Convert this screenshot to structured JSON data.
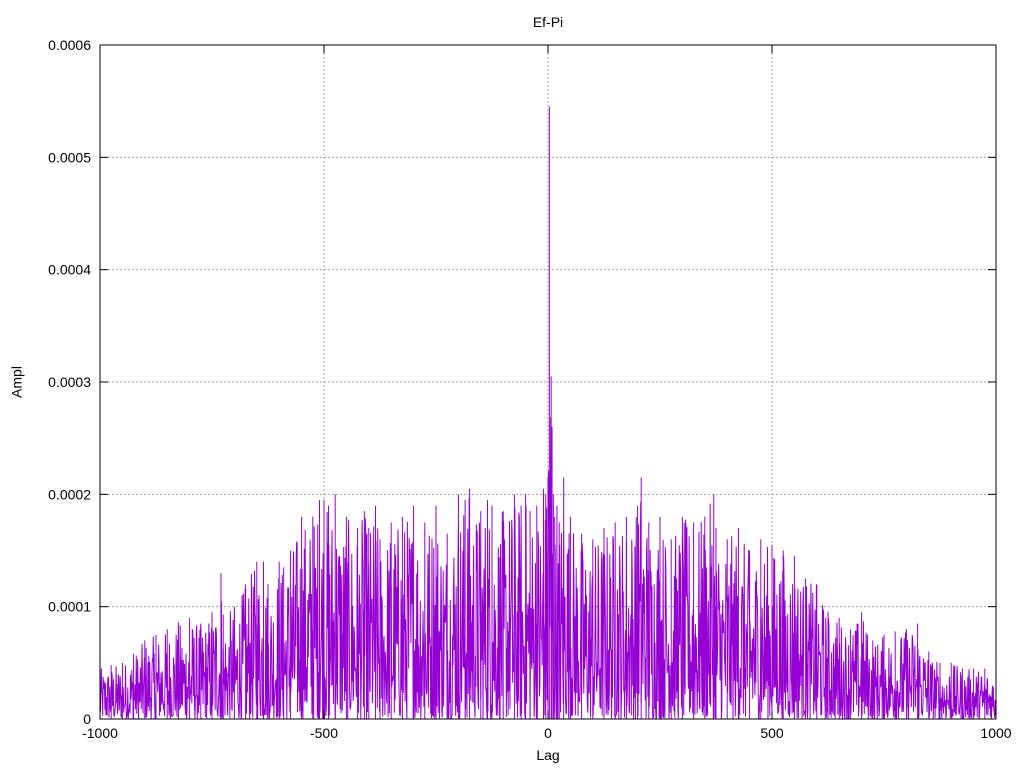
{
  "chart_data": {
    "type": "line",
    "title": "Ef-Pi",
    "xlabel": "Lag",
    "ylabel": "Ampl",
    "xlim": [
      -1000,
      1000
    ],
    "ylim": [
      0,
      0.0006
    ],
    "x_ticks": [
      -1000,
      -500,
      0,
      500,
      1000
    ],
    "x_tick_labels": [
      "-1000",
      "-500",
      "0",
      "500",
      "1000"
    ],
    "y_ticks": [
      0,
      0.0001,
      0.0002,
      0.0003,
      0.0004,
      0.0005,
      0.0006
    ],
    "y_tick_labels": [
      "0",
      "0.0001",
      "0.0002",
      "0.0003",
      "0.0004",
      "0.0005",
      "0.0006"
    ],
    "grid": true,
    "line_color": "#9400d3",
    "series": [
      {
        "x": [
          -1000,
          -975,
          -950,
          -925,
          -900,
          -875,
          -850,
          -825,
          -800,
          -775,
          -750,
          -730,
          -725,
          -700,
          -675,
          -650,
          -635,
          -625,
          -600,
          -590,
          -575,
          -550,
          -525,
          -510,
          -500,
          -490,
          -475,
          -450,
          -425,
          -410,
          -400,
          -385,
          -375,
          -350,
          -325,
          -300,
          -275,
          -250,
          -225,
          -200,
          -185,
          -175,
          -150,
          -135,
          -125,
          -100,
          -75,
          -60,
          -50,
          -40,
          -25,
          -10,
          -5,
          0,
          3,
          7,
          9,
          12,
          15,
          20,
          25,
          35,
          50,
          75,
          100,
          125,
          150,
          175,
          200,
          208,
          225,
          250,
          275,
          300,
          325,
          350,
          370,
          375,
          400,
          425,
          450,
          475,
          500,
          525,
          550,
          575,
          600,
          625,
          650,
          675,
          700,
          725,
          750,
          775,
          800,
          825,
          850,
          875,
          900,
          925,
          950,
          975,
          1000
        ],
        "y": [
          4.5e-05,
          4.8e-05,
          5e-05,
          5.8e-05,
          7e-05,
          7.5e-05,
          8e-05,
          8.6e-05,
          9e-05,
          8.5e-05,
          9.5e-05,
          0.00013,
          9.3e-05,
          0.0001,
          0.00012,
          0.00014,
          0.00014,
          0.00012,
          0.00014,
          0.000135,
          0.00015,
          0.00018,
          0.00018,
          0.000195,
          0.000195,
          0.00019,
          0.0002,
          0.00018,
          0.00017,
          0.000185,
          0.00017,
          0.00019,
          0.00016,
          0.000175,
          0.00018,
          0.00019,
          0.000175,
          0.00019,
          0.000165,
          0.0002,
          0.000195,
          0.000205,
          0.000185,
          0.000195,
          0.00019,
          0.000185,
          0.0002,
          0.00019,
          0.0002,
          0.000185,
          0.00019,
          0.000205,
          0.0002,
          0.000215,
          0.000545,
          0.000305,
          0.00026,
          0.0002,
          0.00018,
          0.00019,
          0.000175,
          0.000215,
          0.00018,
          0.000165,
          0.00016,
          0.00017,
          0.000175,
          0.00018,
          0.00019,
          0.000215,
          0.000175,
          0.00018,
          0.00016,
          0.00018,
          0.000175,
          0.00018,
          0.0002,
          0.00017,
          0.00016,
          0.00017,
          0.00015,
          0.00016,
          0.000155,
          0.00015,
          0.000145,
          0.000125,
          0.00012,
          9.5e-05,
          9e-05,
          8e-05,
          9.5e-05,
          7e-05,
          7.5e-05,
          7.8e-05,
          8e-05,
          8.5e-05,
          6e-05,
          5e-05,
          5e-05,
          4.5e-05,
          4.5e-05,
          4.5e-05,
          4.5e-05
        ]
      }
    ]
  }
}
